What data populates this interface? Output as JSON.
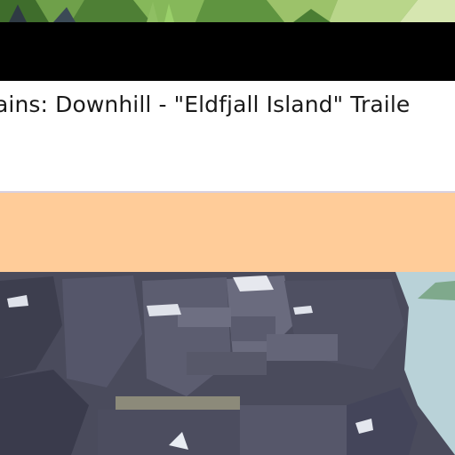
{
  "video": {
    "title": "ains: Downhill - \"Eldfjall Island\" Traile"
  },
  "colors": {
    "accent_band": "#ffcc99",
    "panel_bg": "#ffffff",
    "bar": "#000000"
  },
  "images": {
    "top_thumbnail": "grass-landscape",
    "bottom_thumbnail": "rocky-cliff-by-sea"
  }
}
